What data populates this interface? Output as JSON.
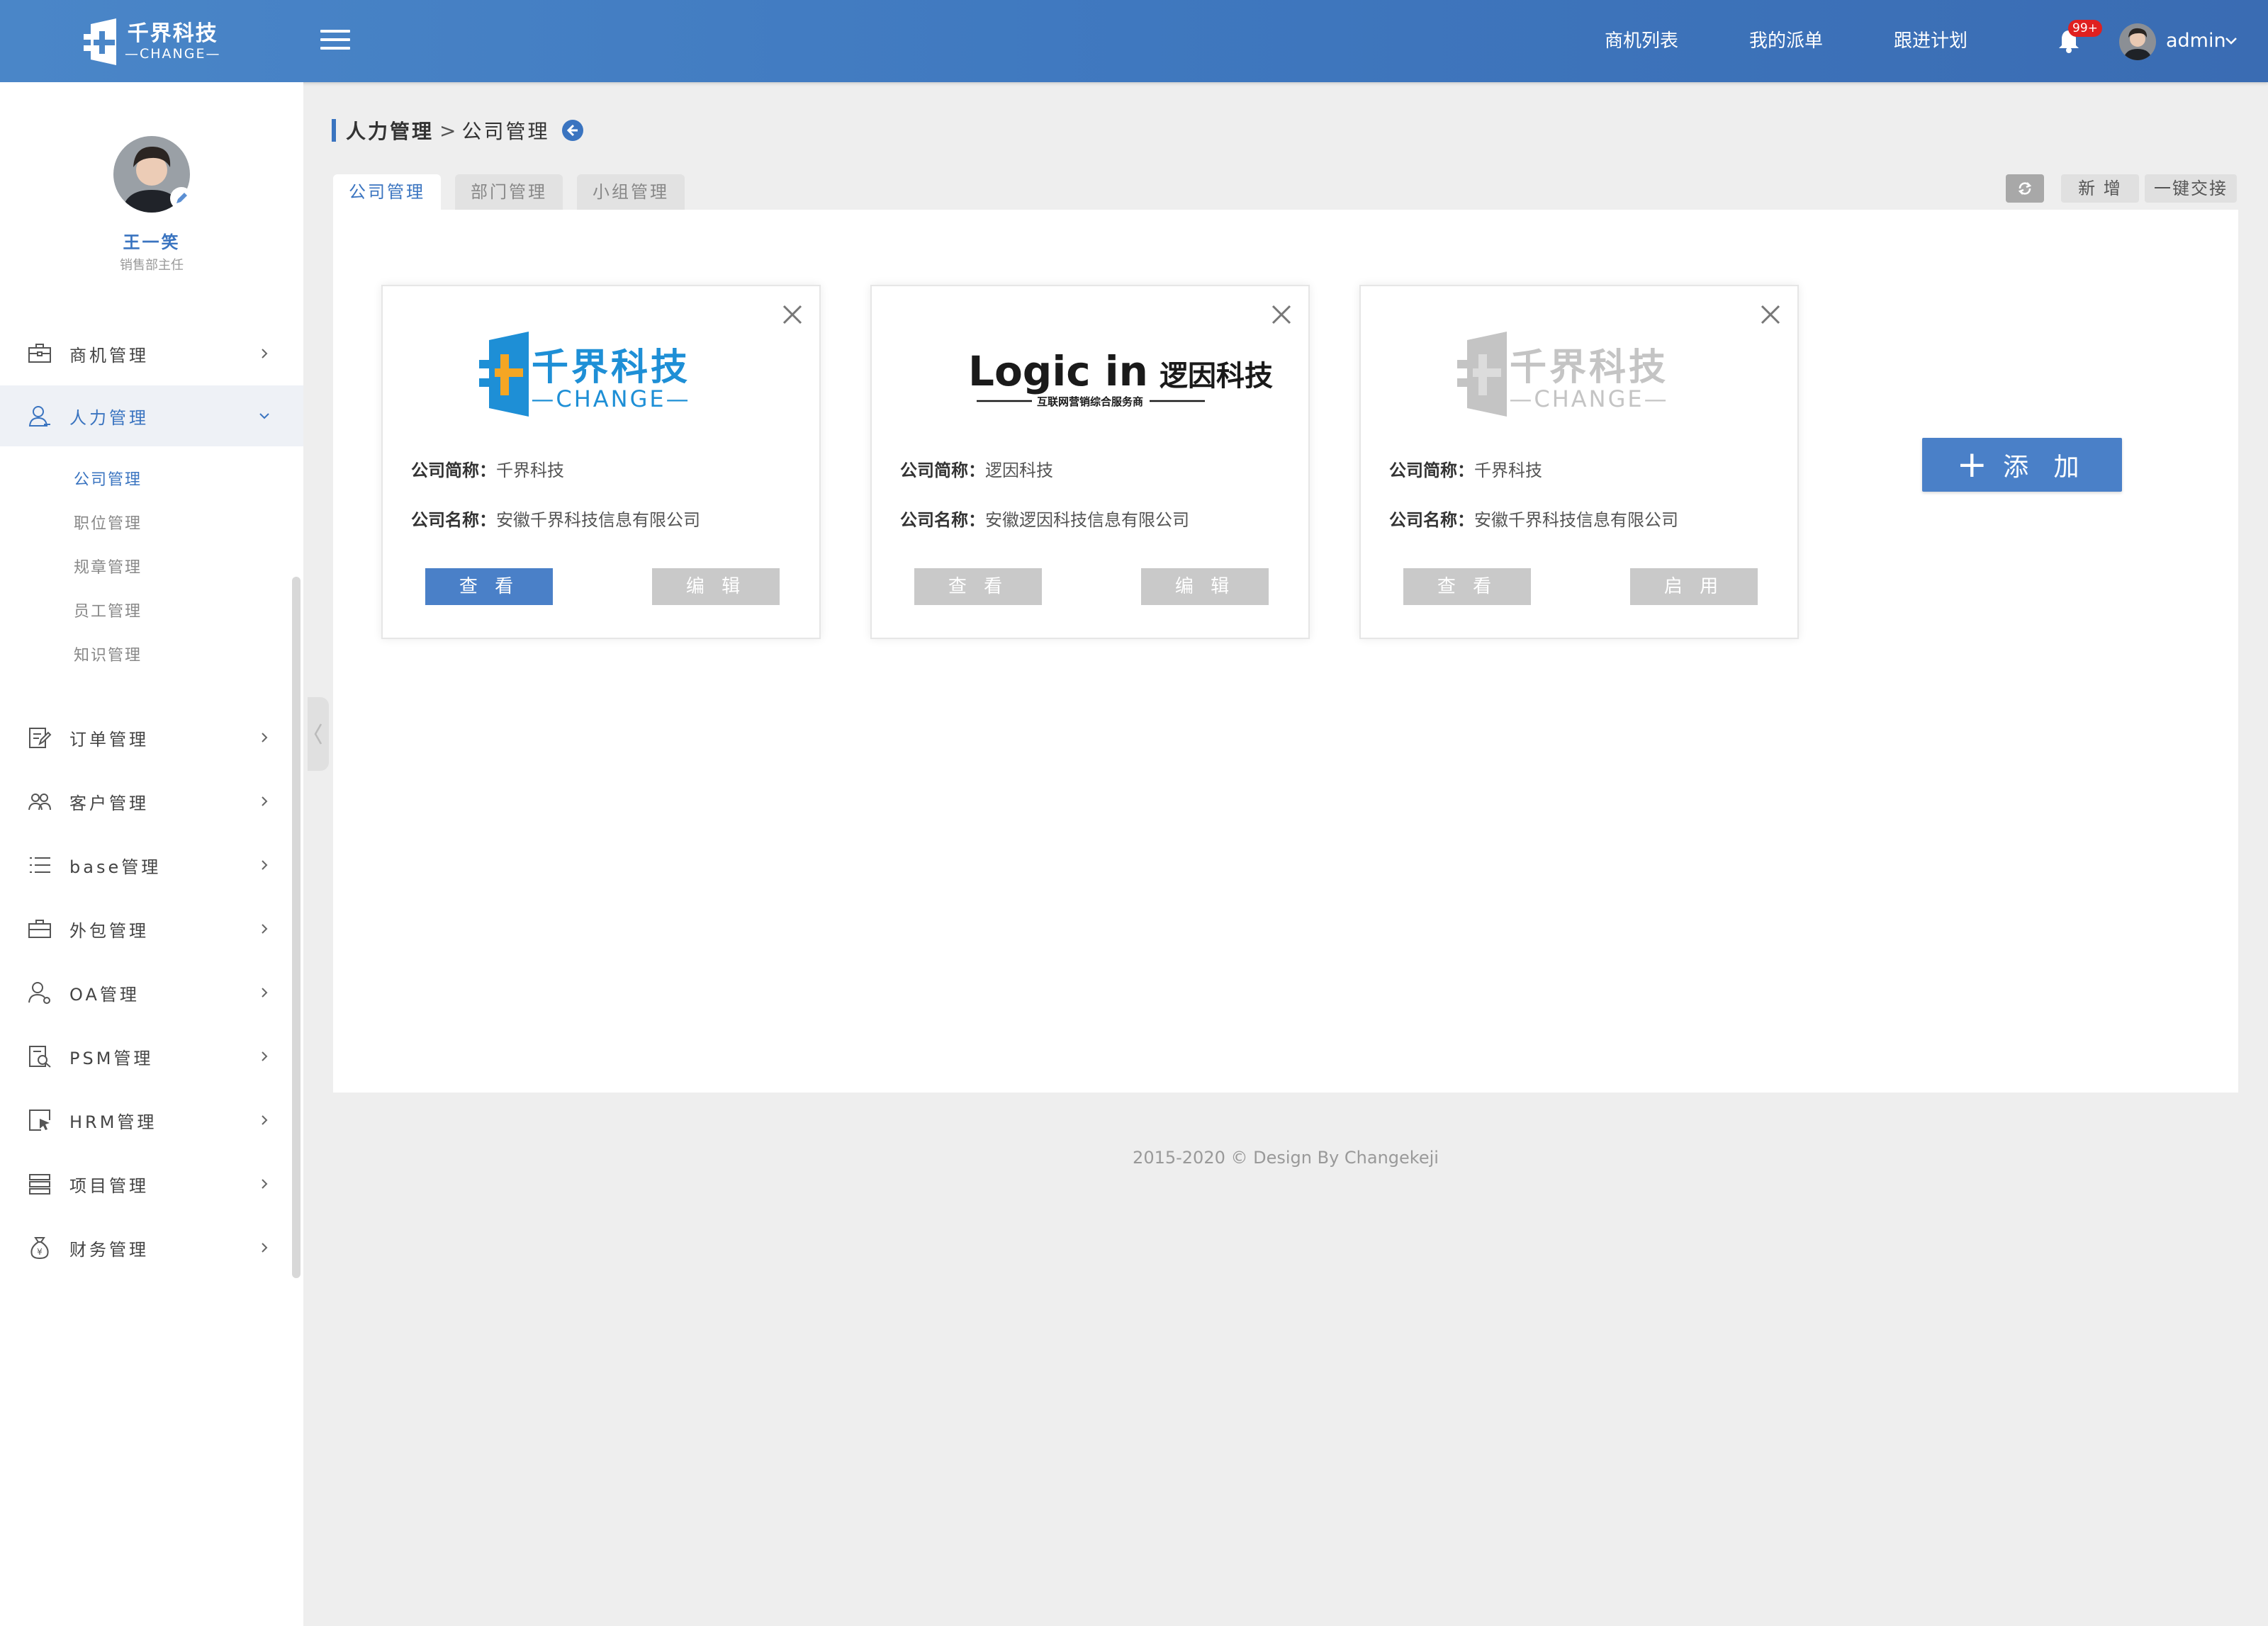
{
  "header": {
    "brand_cn": "千界科技",
    "brand_en": "—CHANGE—",
    "nav": [
      "商机列表",
      "我的派单",
      "跟进计划"
    ],
    "notification_badge": "99+",
    "user_name": "admin"
  },
  "sidebar": {
    "profile_name": "王一笑",
    "profile_role": "销售部主任",
    "menu": [
      {
        "label": "商机管理",
        "icon": "briefcase-icon"
      },
      {
        "label": "人力管理",
        "icon": "user-icon",
        "expanded": true
      },
      {
        "label": "订单管理",
        "icon": "edit-doc-icon"
      },
      {
        "label": "客户管理",
        "icon": "group-icon"
      },
      {
        "label": "base管理",
        "icon": "list-icon"
      },
      {
        "label": "外包管理",
        "icon": "toolbox-icon"
      },
      {
        "label": "OA管理",
        "icon": "user-gear-icon"
      },
      {
        "label": "PSM管理",
        "icon": "doc-search-icon"
      },
      {
        "label": "HRM管理",
        "icon": "cursor-box-icon"
      },
      {
        "label": "项目管理",
        "icon": "stack-icon"
      },
      {
        "label": "财务管理",
        "icon": "moneybag-icon"
      }
    ],
    "submenu": [
      "公司管理",
      "职位管理",
      "规章管理",
      "员工管理",
      "知识管理"
    ]
  },
  "breadcrumb": {
    "first": "人力管理",
    "separator": ">",
    "second": "公司管理"
  },
  "tabs": [
    "公司管理",
    "部门管理",
    "小组管理"
  ],
  "toolbar": {
    "new_label": "新 增",
    "handover_label": "一键交接"
  },
  "cards": [
    {
      "short_label": "公司简称：",
      "short_value": "千界科技",
      "name_label": "公司名称：",
      "name_value": "安徽千界科技信息有限公司",
      "btn_view": "查 看",
      "btn_action": "编 辑",
      "logo_cn": "千界科技",
      "logo_en": "—CHANGE—"
    },
    {
      "short_label": "公司简称：",
      "short_value": "逻因科技",
      "name_label": "公司名称：",
      "name_value": "安徽逻因科技信息有限公司",
      "btn_view": "查 看",
      "btn_action": "编 辑",
      "logo_main": "Logic in",
      "logo_cn": "逻因科技",
      "logo_sub": "互联网营销综合服务商"
    },
    {
      "short_label": "公司简称：",
      "short_value": "千界科技",
      "name_label": "公司名称：",
      "name_value": "安徽千界科技信息有限公司",
      "btn_view": "查 看",
      "btn_action": "启 用",
      "logo_cn": "千界科技",
      "logo_en": "—CHANGE—"
    }
  ],
  "add_button": "添 加",
  "footer": "2015-2020 © Design By Changekeji",
  "colors": {
    "primary": "#4a80c8",
    "header_start": "#4a86c8",
    "header_end": "#3a6cb3",
    "logo_blue": "#1e8fd6",
    "logo_orange": "#f5a623",
    "disabled": "#c9c9c9"
  }
}
